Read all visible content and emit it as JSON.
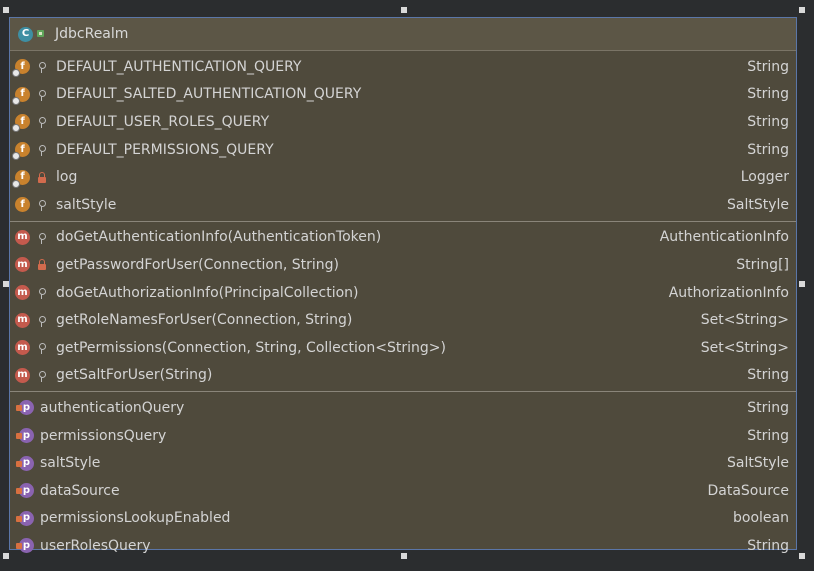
{
  "node": {
    "title": "JdbcRealm",
    "class_icon": "class-icon",
    "fields": [
      {
        "name": "DEFAULT_AUTHENTICATION_QUERY",
        "type": "String",
        "visibility": "public",
        "static": true
      },
      {
        "name": "DEFAULT_SALTED_AUTHENTICATION_QUERY",
        "type": "String",
        "visibility": "public",
        "static": true
      },
      {
        "name": "DEFAULT_USER_ROLES_QUERY",
        "type": "String",
        "visibility": "public",
        "static": true
      },
      {
        "name": "DEFAULT_PERMISSIONS_QUERY",
        "type": "String",
        "visibility": "public",
        "static": true
      },
      {
        "name": "log",
        "type": "Logger",
        "visibility": "private",
        "static": true
      },
      {
        "name": "saltStyle",
        "type": "SaltStyle",
        "visibility": "public",
        "static": false
      }
    ],
    "methods": [
      {
        "name": "doGetAuthenticationInfo(AuthenticationToken)",
        "type": "AuthenticationInfo",
        "visibility": "public"
      },
      {
        "name": "getPasswordForUser(Connection, String)",
        "type": "String[]",
        "visibility": "private"
      },
      {
        "name": "doGetAuthorizationInfo(PrincipalCollection)",
        "type": "AuthorizationInfo",
        "visibility": "public"
      },
      {
        "name": "getRoleNamesForUser(Connection, String)",
        "type": "Set<String>",
        "visibility": "public"
      },
      {
        "name": "getPermissions(Connection, String, Collection<String>)",
        "type": "Set<String>",
        "visibility": "public"
      },
      {
        "name": "getSaltForUser(String)",
        "type": "String",
        "visibility": "public"
      }
    ],
    "properties": [
      {
        "name": "authenticationQuery",
        "type": "String"
      },
      {
        "name": "permissionsQuery",
        "type": "String"
      },
      {
        "name": "saltStyle",
        "type": "SaltStyle"
      },
      {
        "name": "dataSource",
        "type": "DataSource"
      },
      {
        "name": "permissionsLookupEnabled",
        "type": "boolean"
      },
      {
        "name": "userRolesQuery",
        "type": "String"
      }
    ],
    "badge_letters": {
      "field": "f",
      "method": "m",
      "property": "p",
      "class": "C"
    }
  }
}
